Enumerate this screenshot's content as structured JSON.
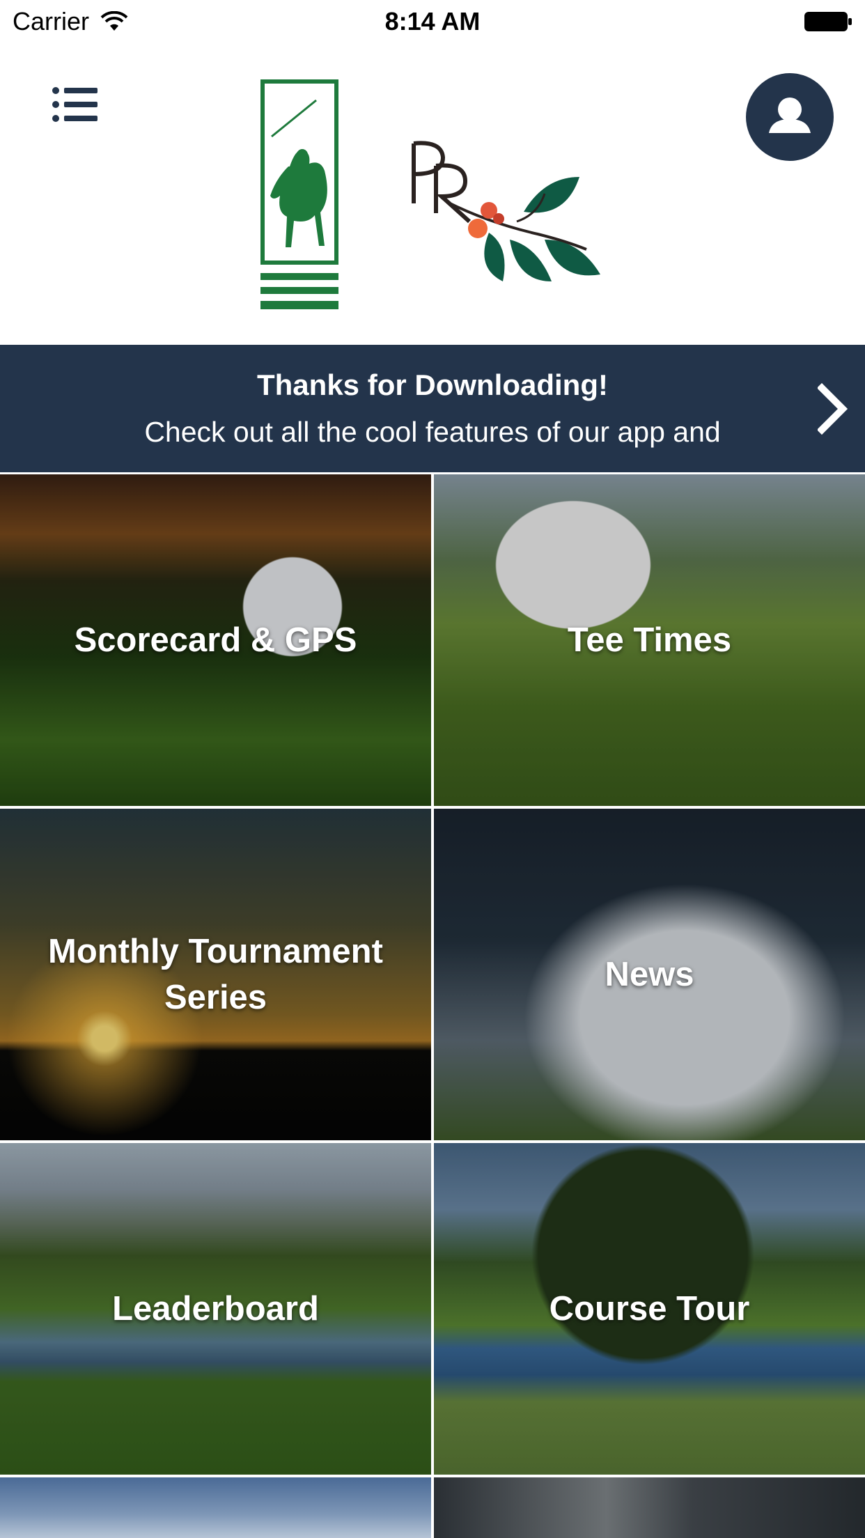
{
  "status_bar": {
    "carrier": "Carrier",
    "time": "8:14 AM"
  },
  "header": {
    "menu_icon": "list-icon",
    "profile_icon": "person-icon"
  },
  "banner": {
    "title": "Thanks for Downloading!",
    "text": "Check out all the cool features of our app and",
    "chevron_icon": "chevron-right-icon"
  },
  "tiles": [
    {
      "label": "Scorecard & GPS"
    },
    {
      "label": "Tee Times"
    },
    {
      "label": "Monthly Tournament Series"
    },
    {
      "label": "News"
    },
    {
      "label": "Leaderboard"
    },
    {
      "label": "Course Tour"
    }
  ],
  "colors": {
    "brand_navy": "#23344b",
    "logo_green": "#1e7a3c"
  }
}
